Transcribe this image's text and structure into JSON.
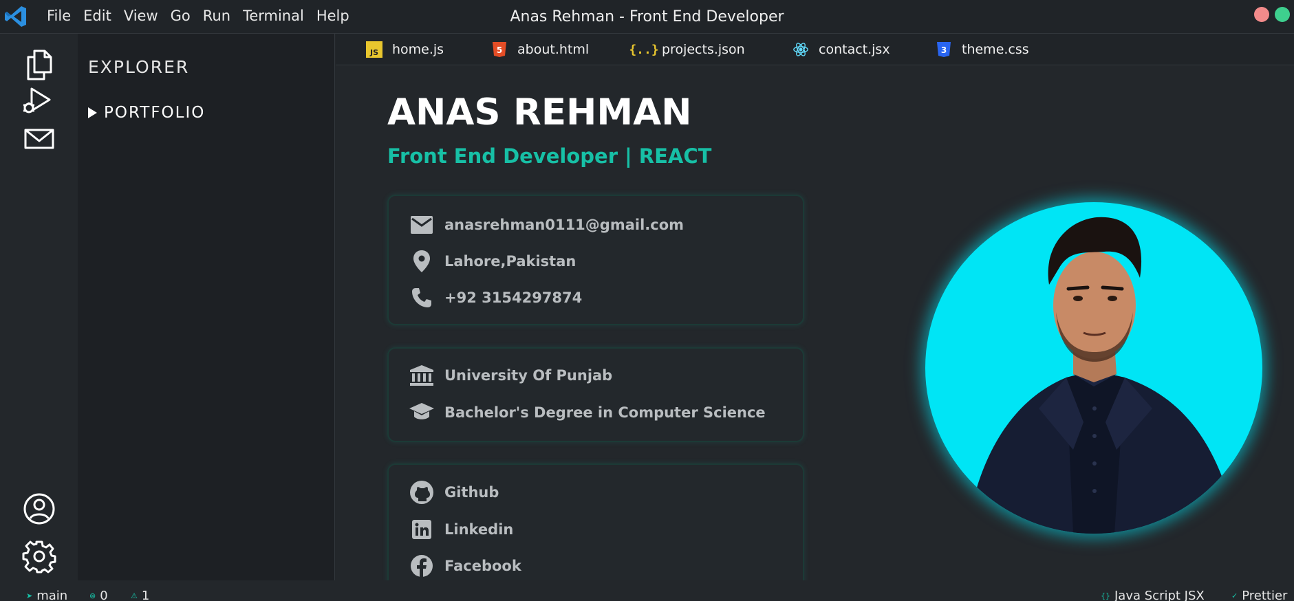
{
  "menu": {
    "file": "File",
    "edit": "Edit",
    "view": "View",
    "go": "Go",
    "run": "Run",
    "terminal": "Terminal",
    "help": "Help"
  },
  "window_title": "Anas Rehman - Front End Developer",
  "sidebar": {
    "title": "EXPLORER",
    "folder": "PORTFOLIO"
  },
  "tabs": [
    {
      "label": "home.js",
      "icon": "js-file-icon"
    },
    {
      "label": "about.html",
      "icon": "html5-icon"
    },
    {
      "label": "projects.json",
      "icon": "json-braces-icon"
    },
    {
      "label": "contact.jsx",
      "icon": "react-icon"
    },
    {
      "label": "theme.css",
      "icon": "css3-icon"
    }
  ],
  "profile": {
    "name": "ANAS REHMAN",
    "role": "Front End Developer | REACT"
  },
  "contact": {
    "email": "anasrehman0111@gmail.com",
    "location": "Lahore,Pakistan",
    "phone": "+92 3154297874"
  },
  "education": {
    "university": "University Of Punjab",
    "degree": "Bachelor's Degree in Computer Science"
  },
  "social": {
    "github": "Github",
    "linkedin": "Linkedin",
    "facebook": "Facebook"
  },
  "statusbar": {
    "branch": "main",
    "errors": "0",
    "warnings": "1",
    "language": "Java Script JSX",
    "formatter": "Prettier"
  },
  "colors": {
    "accent": "#17c0a6",
    "avatar_bg": "#00e5f5",
    "close": "#f28b8b",
    "maximize": "#3ecf8e"
  }
}
